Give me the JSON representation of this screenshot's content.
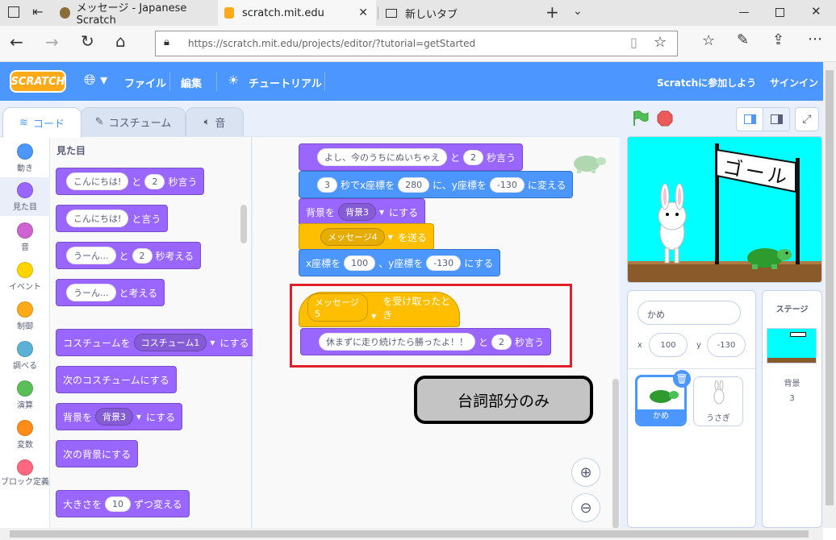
{
  "browser": {
    "tabs": [
      {
        "label": "メッセージ - Japanese Scratch"
      },
      {
        "label": "scratch.mit.edu"
      },
      {
        "label": "新しいタブ"
      }
    ],
    "url": "https://scratch.mit.edu/projects/editor/?tutorial=getStarted"
  },
  "menu": {
    "logo": "SCRATCH",
    "file": "ファイル",
    "edit": "編集",
    "tutorial": "チュートリアル",
    "join": "Scratchに参加しよう",
    "signin": "サインイン"
  },
  "editor_tabs": {
    "code": "コード",
    "costume": "コスチューム",
    "sound": "音"
  },
  "categories": [
    {
      "label": "動き",
      "color": "#4c97ff"
    },
    {
      "label": "見た目",
      "color": "#9966ff"
    },
    {
      "label": "音",
      "color": "#cf63cf"
    },
    {
      "label": "イベント",
      "color": "#ffd500"
    },
    {
      "label": "制御",
      "color": "#ffab19"
    },
    {
      "label": "調べる",
      "color": "#5cb1d6"
    },
    {
      "label": "演算",
      "color": "#59c059"
    },
    {
      "label": "変数",
      "color": "#ff8c1a"
    },
    {
      "label": "ブロック定義",
      "color": "#ff6680"
    }
  ],
  "palette": {
    "heading": "見た目",
    "b1": {
      "a": "こんにちは!",
      "b": "と",
      "c": "2",
      "d": "秒言う"
    },
    "b2": {
      "a": "こんにちは!",
      "b": "と言う"
    },
    "b3": {
      "a": "うーん...",
      "b": "と",
      "c": "2",
      "d": "秒考える"
    },
    "b4": {
      "a": "うーん...",
      "b": "と考える"
    },
    "b5": {
      "a": "コスチュームを",
      "b": "コスチューム1",
      "c": "にする"
    },
    "b6": {
      "a": "次のコスチュームにする"
    },
    "b7": {
      "a": "背景を",
      "b": "背景3",
      "c": "にする"
    },
    "b8": {
      "a": "次の背景にする"
    },
    "b9": {
      "a": "大きさを",
      "b": "10",
      "c": "ずつ変える"
    }
  },
  "script": {
    "s1": {
      "a": "よし、今のうちにぬいちゃえ",
      "b": "と",
      "c": "2",
      "d": "秒言う"
    },
    "s2": {
      "a": "3",
      "b": "秒でx座標を",
      "c": "280",
      "d": "に、y座標を",
      "e": "-130",
      "f": "に変える"
    },
    "s3": {
      "a": "背景を",
      "b": "背景3",
      "c": "にする"
    },
    "s4": {
      "a": "メッセージ4",
      "b": "を送る"
    },
    "s5": {
      "a": "x座標を",
      "b": "100",
      "c": "、y座標を",
      "d": "-130",
      "e": "にする"
    },
    "h1": {
      "a": "メッセージ5",
      "b": "を受け取ったとき"
    },
    "h2": {
      "a": "休まずに走り続けたら勝ったよ！！",
      "b": "と",
      "c": "2",
      "d": "秒言う"
    },
    "callout": "台詞部分のみ",
    "highlight_color": "#e0202a"
  },
  "stage": {
    "goal_text": "ゴール"
  },
  "sprite_pane": {
    "name": "かめ",
    "x_label": "x",
    "x_value": "100",
    "y_label": "y",
    "y_value": "-130",
    "sprites": [
      {
        "label": "かめ"
      },
      {
        "label": "うさぎ"
      }
    ]
  },
  "stage_pane": {
    "title": "ステージ",
    "backdrop_label": "背景",
    "backdrop_count": "3"
  }
}
